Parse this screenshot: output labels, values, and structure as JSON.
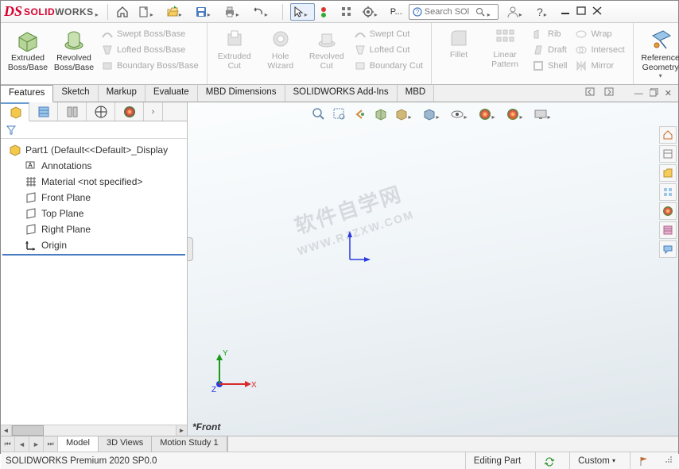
{
  "app": {
    "name_solid": "SOLID",
    "name_works": "WORKS"
  },
  "titlebar": {
    "p_label": "P...",
    "search_placeholder": "Search SOl"
  },
  "ribbon": {
    "extruded_boss": "Extruded Boss/Base",
    "revolved_boss": "Revolved Boss/Base",
    "swept_boss": "Swept Boss/Base",
    "lofted_boss": "Lofted Boss/Base",
    "boundary_boss": "Boundary Boss/Base",
    "extruded_cut": "Extruded Cut",
    "hole_wizard": "Hole Wizard",
    "revolved_cut": "Revolved Cut",
    "swept_cut": "Swept Cut",
    "lofted_cut": "Lofted Cut",
    "boundary_cut": "Boundary Cut",
    "fillet": "Fillet",
    "linear_pattern": "Linear Pattern",
    "rib": "Rib",
    "draft": "Draft",
    "shell": "Shell",
    "wrap": "Wrap",
    "intersect": "Intersect",
    "mirror": "Mirror",
    "ref_geom": "Reference Geometry"
  },
  "tabs": {
    "features": "Features",
    "sketch": "Sketch",
    "markup": "Markup",
    "evaluate": "Evaluate",
    "mbd_dim": "MBD Dimensions",
    "addins": "SOLIDWORKS Add-Ins",
    "mbd": "MBD"
  },
  "tree": {
    "root": "Part1  (Default<<Default>_Display",
    "annotations": "Annotations",
    "material": "Material <not specified>",
    "front": "Front Plane",
    "top": "Top Plane",
    "right": "Right Plane",
    "origin": "Origin"
  },
  "canvas": {
    "view_name": "*Front",
    "watermark_l1": "软件自学网",
    "watermark_l2": "WWW.RJZXW.COM",
    "axis_x": "X",
    "axis_y": "Y",
    "axis_z": "Z"
  },
  "bottom_tabs": {
    "model": "Model",
    "views3d": "3D Views",
    "motion": "Motion Study 1"
  },
  "status": {
    "version": "SOLIDWORKS Premium 2020 SP0.0",
    "mode": "Editing Part",
    "custom": "Custom"
  }
}
